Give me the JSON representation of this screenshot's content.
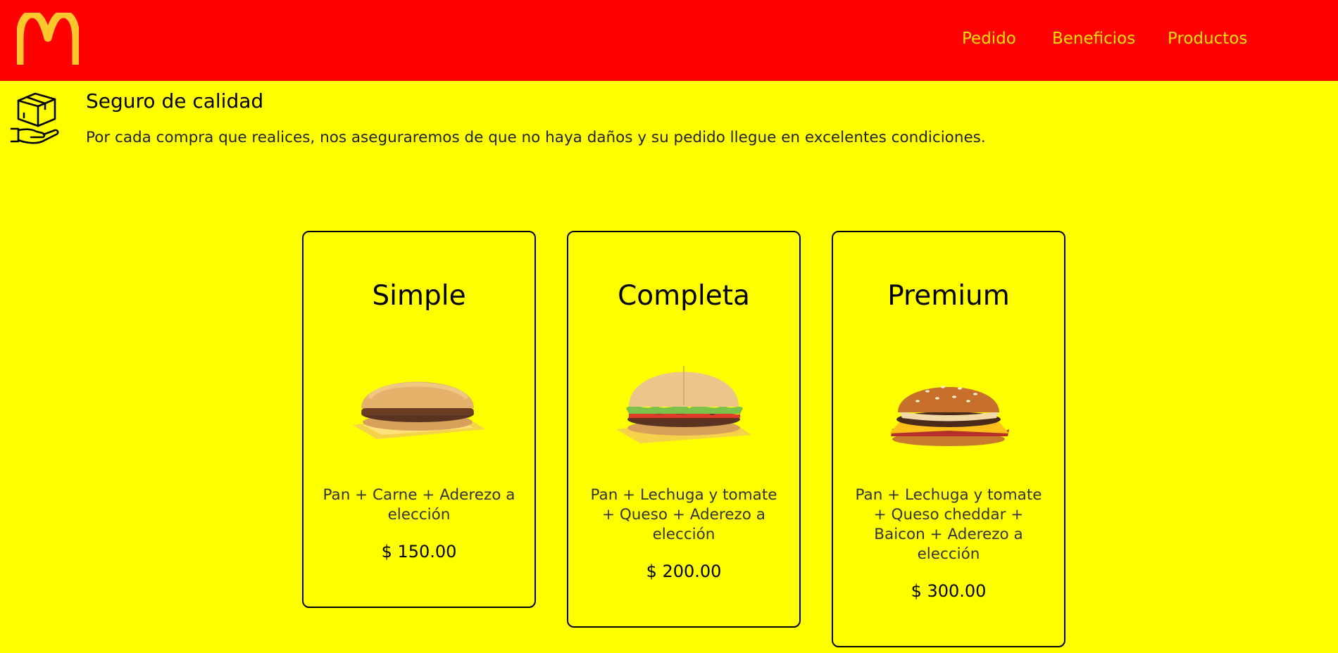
{
  "colors": {
    "header_bg": "#ff0000",
    "page_bg": "#ffff00",
    "nav_text": "#ffe100",
    "logo": "#ffc72c"
  },
  "header": {
    "logo_icon": "golden-arches-icon",
    "nav": [
      {
        "label": "Pedido"
      },
      {
        "label": "Beneficios"
      },
      {
        "label": "Productos"
      }
    ]
  },
  "quality": {
    "icon": "box-in-hand-icon",
    "title": "Seguro de calidad",
    "text": "Por cada compra que realices, nos aseguraremos de que no haya daños y su pedido llegue en excelentes condiciones."
  },
  "products": [
    {
      "name": "Simple",
      "image": "plain-hamburger-image",
      "description": "Pan + Carne + Aderezo a elección",
      "price": "$ 150.00"
    },
    {
      "name": "Completa",
      "image": "hamburger-with-lettuce-tomato-image",
      "description": "Pan + Lechuga y tomate + Queso + Aderezo a elección",
      "price": "$ 200.00"
    },
    {
      "name": "Premium",
      "image": "cheddar-bacon-burger-image",
      "description": "Pan + Lechuga y tomate + Queso cheddar + Baicon + Aderezo a elección",
      "price": "$ 300.00"
    }
  ]
}
